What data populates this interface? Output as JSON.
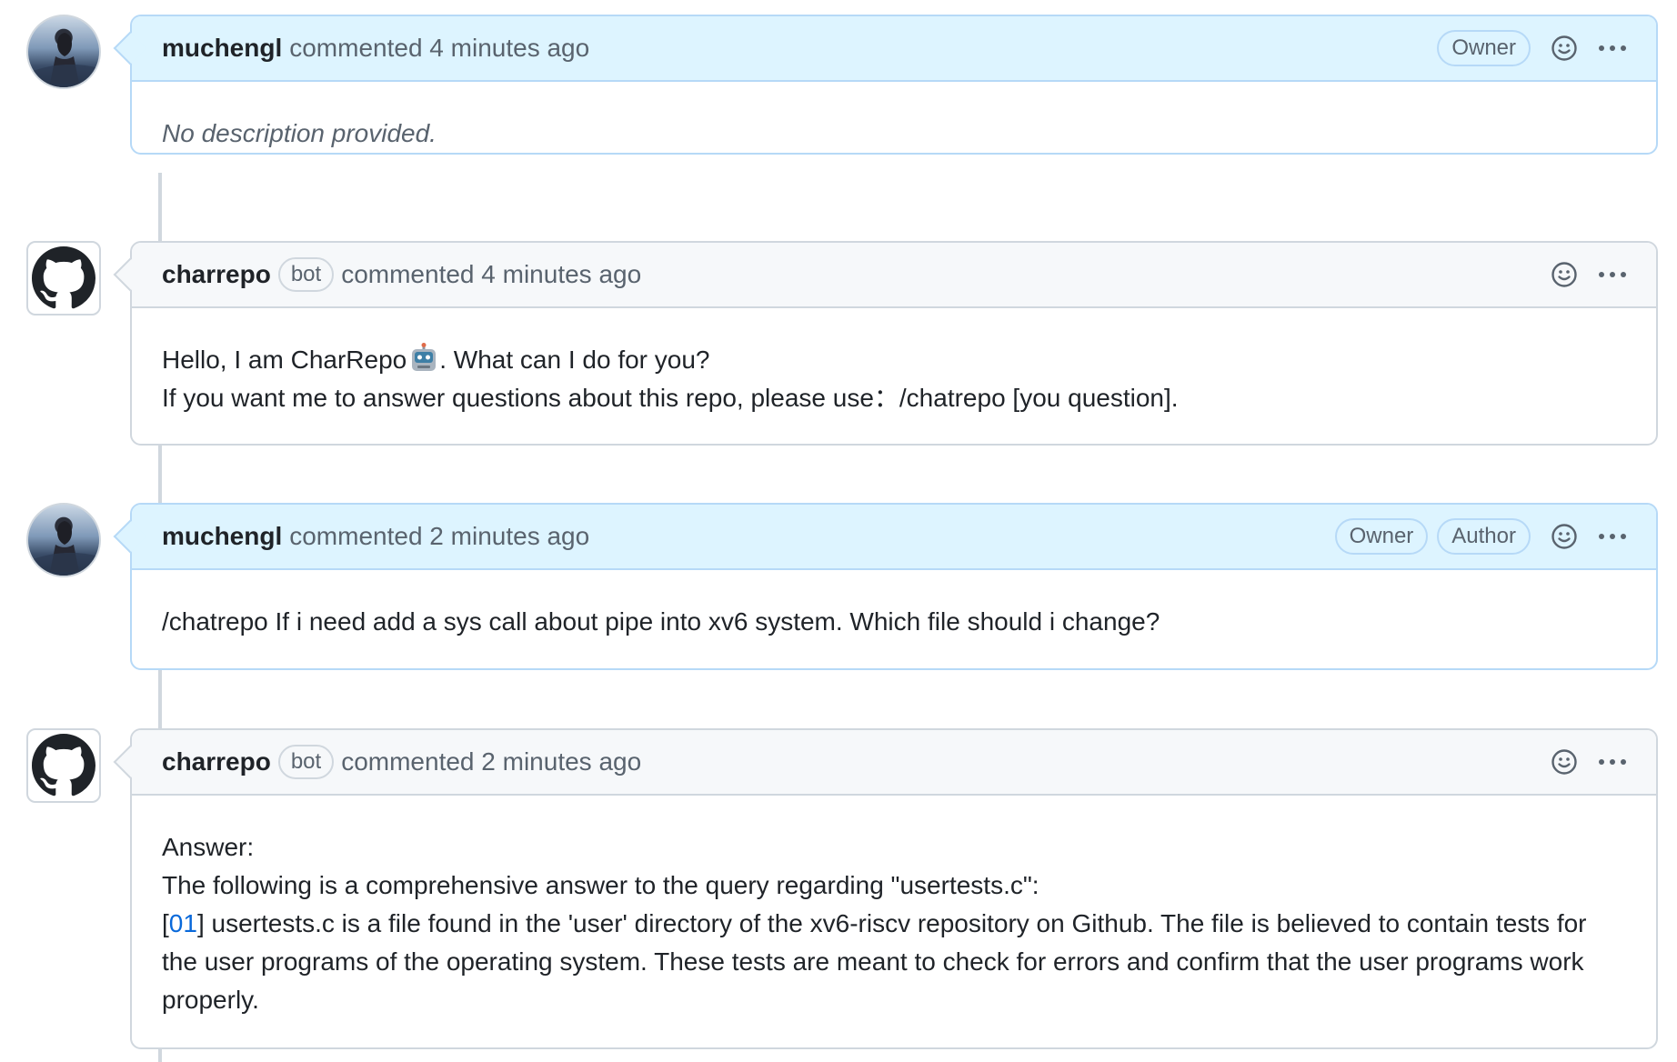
{
  "comments": [
    {
      "author": "muchengl",
      "action": "commented 4 minutes ago",
      "badges": [
        "Owner"
      ],
      "body": "No description provided."
    },
    {
      "author": "charrepo",
      "bot_label": "bot",
      "action": "commented 4 minutes ago",
      "body_line1_a": "Hello, I am CharRepo",
      "body_line1_b": ". What can I do for you?",
      "body_line2": "If you want me to answer questions about this repo, please use：/chatrepo [you question]."
    },
    {
      "author": "muchengl",
      "action": "commented 2 minutes ago",
      "badges": [
        "Owner",
        "Author"
      ],
      "body": "/chatrepo If i need add a sys call about pipe into xv6 system. Which file should i change?"
    },
    {
      "author": "charrepo",
      "bot_label": "bot",
      "action": "commented 2 minutes ago",
      "line1": "Answer:",
      "line2": "The following is a comprehensive answer to the query regarding \"usertests.c\":",
      "ref_open": "[",
      "ref": "01",
      "ref_close": "]",
      "line3": " usertests.c is a file found in the 'user' directory of the xv6-riscv repository on Github. The file is believed to contain tests for the user programs of the operating system. These tests are meant to check for errors and confirm that the user programs work properly."
    }
  ],
  "icons": {
    "reaction": "smiley-icon",
    "more": "kebab-horizontal-icon",
    "bot_avatar": "github-mark-icon",
    "robot_emoji": "robot-emoji-icon"
  },
  "colors": {
    "owner_header_bg": "#ddf4ff",
    "owner_border": "#b6d9f7",
    "default_header_bg": "#f6f8fa",
    "link": "#0969da"
  }
}
